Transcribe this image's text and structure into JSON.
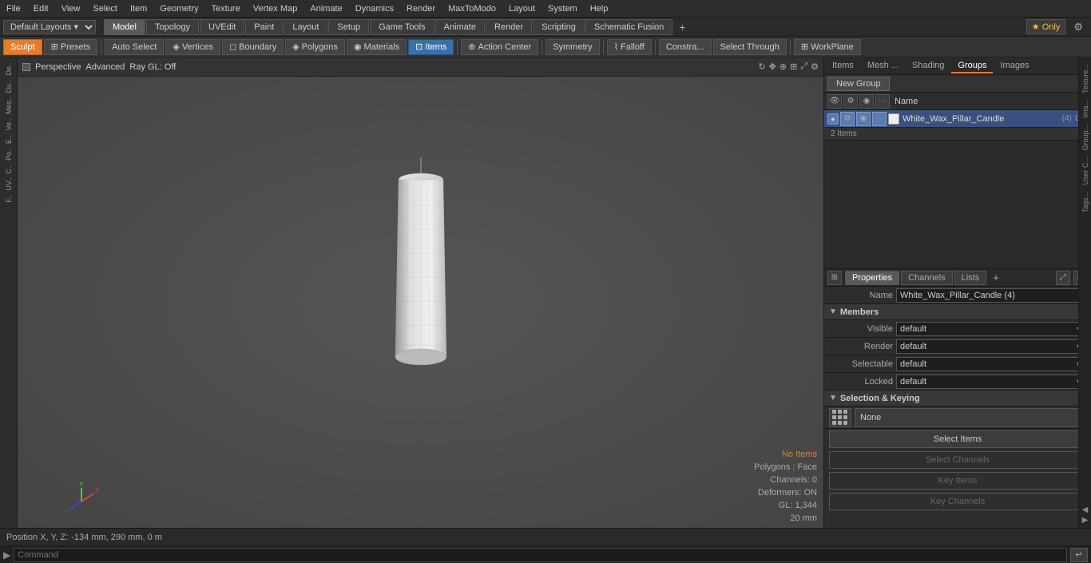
{
  "menubar": {
    "items": [
      "File",
      "Edit",
      "View",
      "Select",
      "Item",
      "Geometry",
      "Texture",
      "Vertex Map",
      "Animate",
      "Dynamics",
      "Render",
      "MaxToModo",
      "Layout",
      "System",
      "Help"
    ]
  },
  "layoutbar": {
    "dropdown": "Default Layouts",
    "tabs": [
      "Model",
      "Topology",
      "UVEdit",
      "Paint",
      "Layout",
      "Setup",
      "Game Tools",
      "Animate",
      "Render",
      "Scripting",
      "Schematic Fusion"
    ],
    "active_tab": "Model",
    "star_only": "★ Only",
    "settings": "⚙"
  },
  "toolbar": {
    "sculpt": "Sculpt",
    "presets": "Presets",
    "auto_select": "Auto Select",
    "vertices": "Vertices",
    "boundary": "Boundary",
    "polygons": "Polygons",
    "materials": "Materials",
    "items": "Items",
    "action_center": "Action Center",
    "symmetry": "Symmetry",
    "falloff": "Falloff",
    "constraints": "Constra...",
    "select_through": "Select Through",
    "workplane": "WorkPlane"
  },
  "viewport": {
    "indicator": "",
    "mode": "Perspective",
    "display": "Advanced",
    "render": "Ray GL: Off",
    "status": {
      "no_items": "No Items",
      "polygons": "Polygons : Face",
      "channels": "Channels: 0",
      "deformers": "Deformers: ON",
      "gl": "GL: 1,344",
      "size": "20 mm"
    }
  },
  "left_toolbar": {
    "labels": [
      "De..",
      "Du..",
      "Mes..",
      "Ve..",
      "E..",
      "Po..",
      "C..",
      "UV..",
      "F.."
    ]
  },
  "right_panel": {
    "tabs": [
      "Items",
      "Mesh ...",
      "Shading",
      "Groups",
      "Images"
    ],
    "active_tab": "Groups",
    "new_group_btn": "New Group",
    "col_header": "Name",
    "group_item": {
      "name": "White_Wax_Pillar_Candle",
      "count": "(4)",
      "sub_count": "G...",
      "items_count": "2 Items"
    }
  },
  "properties": {
    "tabs": [
      "Properties",
      "Channels",
      "Lists"
    ],
    "active_tab": "Properties",
    "plus": "+",
    "name_label": "Name",
    "name_value": "White_Wax_Pillar_Candle (4)",
    "members_section": "Members",
    "visible_label": "Visible",
    "visible_value": "default",
    "render_label": "Render",
    "render_value": "default",
    "selectable_label": "Selectable",
    "selectable_value": "default",
    "locked_label": "Locked",
    "locked_value": "default",
    "sel_key_section": "Selection & Keying",
    "none_btn": "None",
    "select_items_btn": "Select Items",
    "select_channels_btn": "Select Channels",
    "key_items_btn": "Key Items",
    "key_channels_btn": "Key Channels"
  },
  "side_tabs": [
    "Texture...",
    "Ima...",
    "Group...",
    "User C...",
    "Tags..."
  ],
  "statusbar": {
    "label": "Position X, Y, Z:",
    "value": "-134 mm, 290 mm, 0 m"
  },
  "commandbar": {
    "arrow": "▶",
    "placeholder": "Command",
    "exec": "↵"
  }
}
